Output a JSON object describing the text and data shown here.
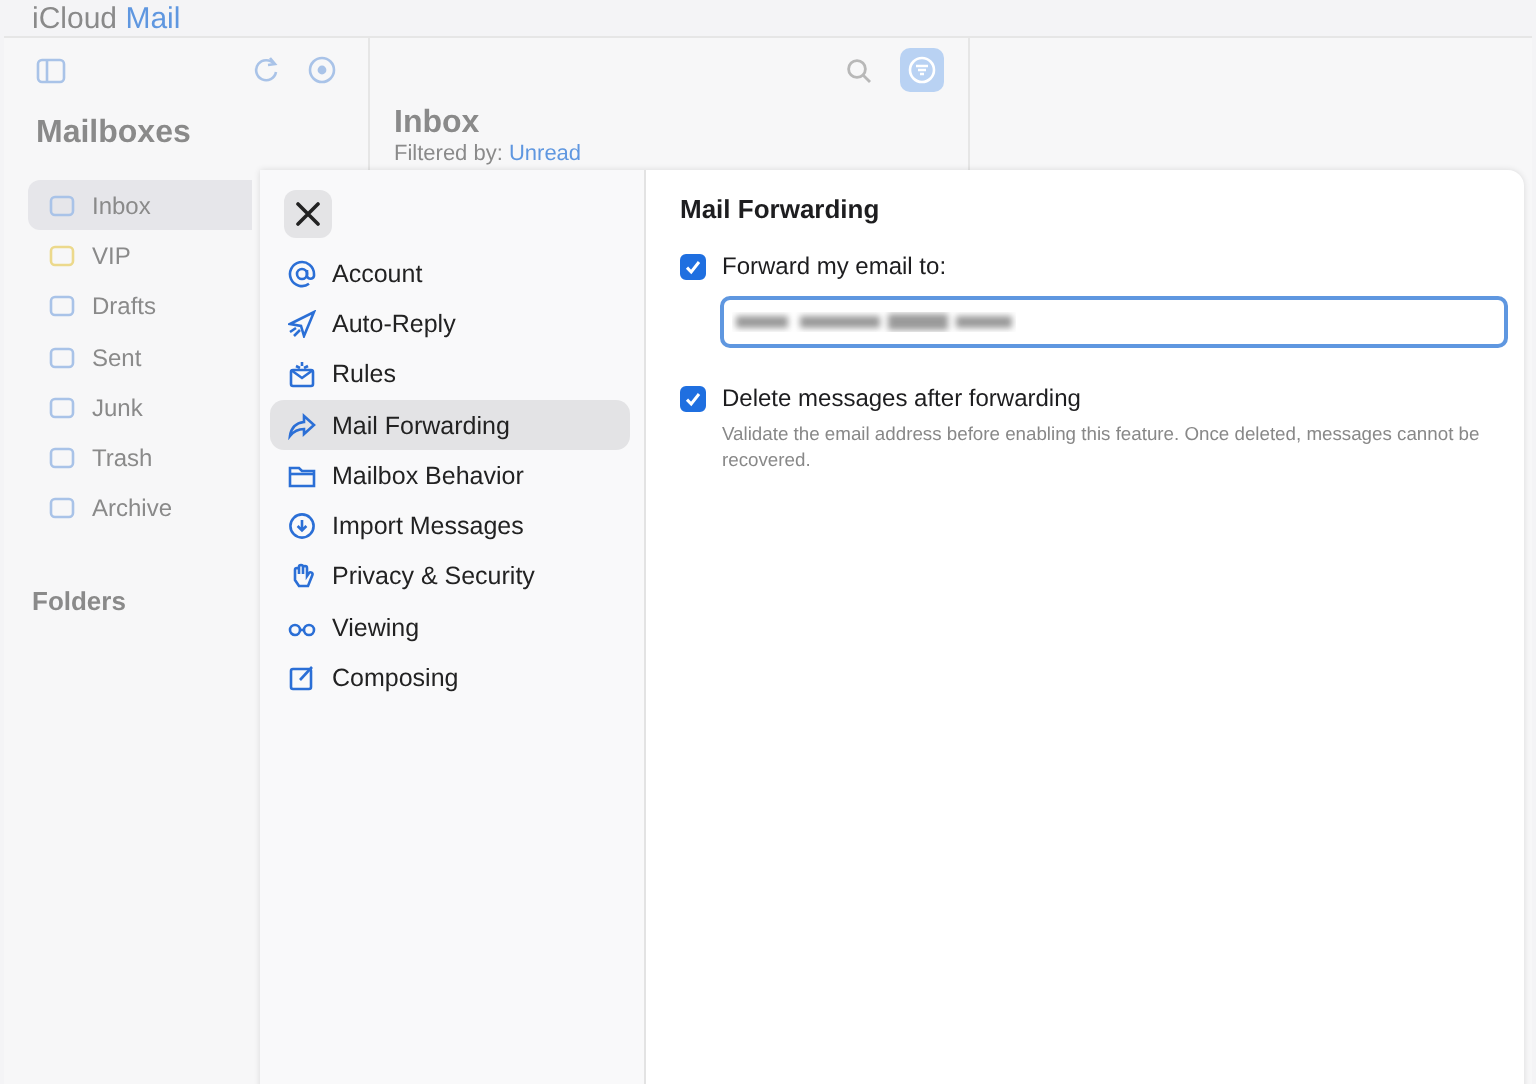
{
  "app_title": {
    "brand": "iCloud",
    "product": "Mail"
  },
  "mailboxes": {
    "title": "Mailboxes",
    "items": [
      {
        "label": "Inbox",
        "selected": true
      },
      {
        "label": "VIP",
        "selected": false
      },
      {
        "label": "Drafts",
        "selected": false
      },
      {
        "label": "Sent",
        "selected": false
      },
      {
        "label": "Junk",
        "selected": false
      },
      {
        "label": "Trash",
        "selected": false
      },
      {
        "label": "Archive",
        "selected": false
      }
    ],
    "folders_title": "Folders"
  },
  "message_list": {
    "title": "Inbox",
    "filter_label": "Filtered by:",
    "filter_value": "Unread"
  },
  "settings": {
    "nav": [
      {
        "label": "Account",
        "selected": false
      },
      {
        "label": "Auto-Reply",
        "selected": false
      },
      {
        "label": "Rules",
        "selected": false
      },
      {
        "label": "Mail Forwarding",
        "selected": true
      },
      {
        "label": "Mailbox Behavior",
        "selected": false
      },
      {
        "label": "Import Messages",
        "selected": false
      },
      {
        "label": "Privacy & Security",
        "selected": false
      },
      {
        "label": "Viewing",
        "selected": false
      },
      {
        "label": "Composing",
        "selected": false
      }
    ],
    "title": "Mail Forwarding",
    "forward": {
      "label": "Forward my email to:",
      "checked": true
    },
    "delete": {
      "label": "Delete messages after forwarding",
      "checked": true,
      "description": "Validate the email address before enabling this feature. Once deleted, messages cannot be recovered."
    }
  }
}
